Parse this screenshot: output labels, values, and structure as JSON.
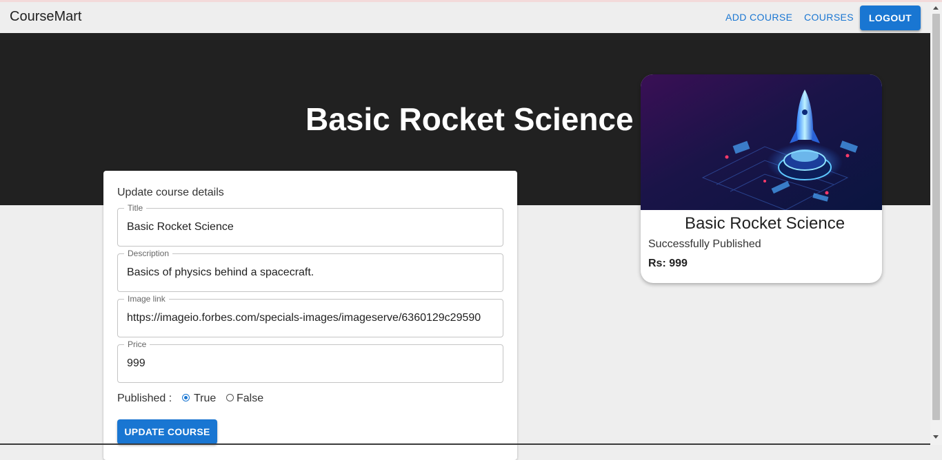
{
  "navbar": {
    "brand": "CourseMart",
    "links": [
      "ADD COURSE",
      "COURSES"
    ],
    "logout_label": "LOGOUT"
  },
  "hero": {
    "title": "Basic Rocket Science"
  },
  "form": {
    "heading": "Update course details",
    "fields": {
      "title": {
        "label": "Title",
        "value": "Basic Rocket Science"
      },
      "description": {
        "label": "Description",
        "value": "Basics of physics behind a spacecraft."
      },
      "image": {
        "label": "Image link",
        "value": "https://imageio.forbes.com/specials-images/imageserve/6360129c29590"
      },
      "price": {
        "label": "Price",
        "value": "999"
      }
    },
    "published_label": "Published :",
    "options": [
      "True",
      "False"
    ],
    "selected": "True",
    "submit_label": "UPDATE COURSE"
  },
  "card": {
    "title": "Basic Rocket Science",
    "status": "Successfully Published",
    "price": "Rs: 999",
    "image_icon": "rocket-illustration"
  },
  "colors": {
    "primary": "#1976d2",
    "hero_bg": "#212121",
    "page_bg": "#eeeeee"
  }
}
